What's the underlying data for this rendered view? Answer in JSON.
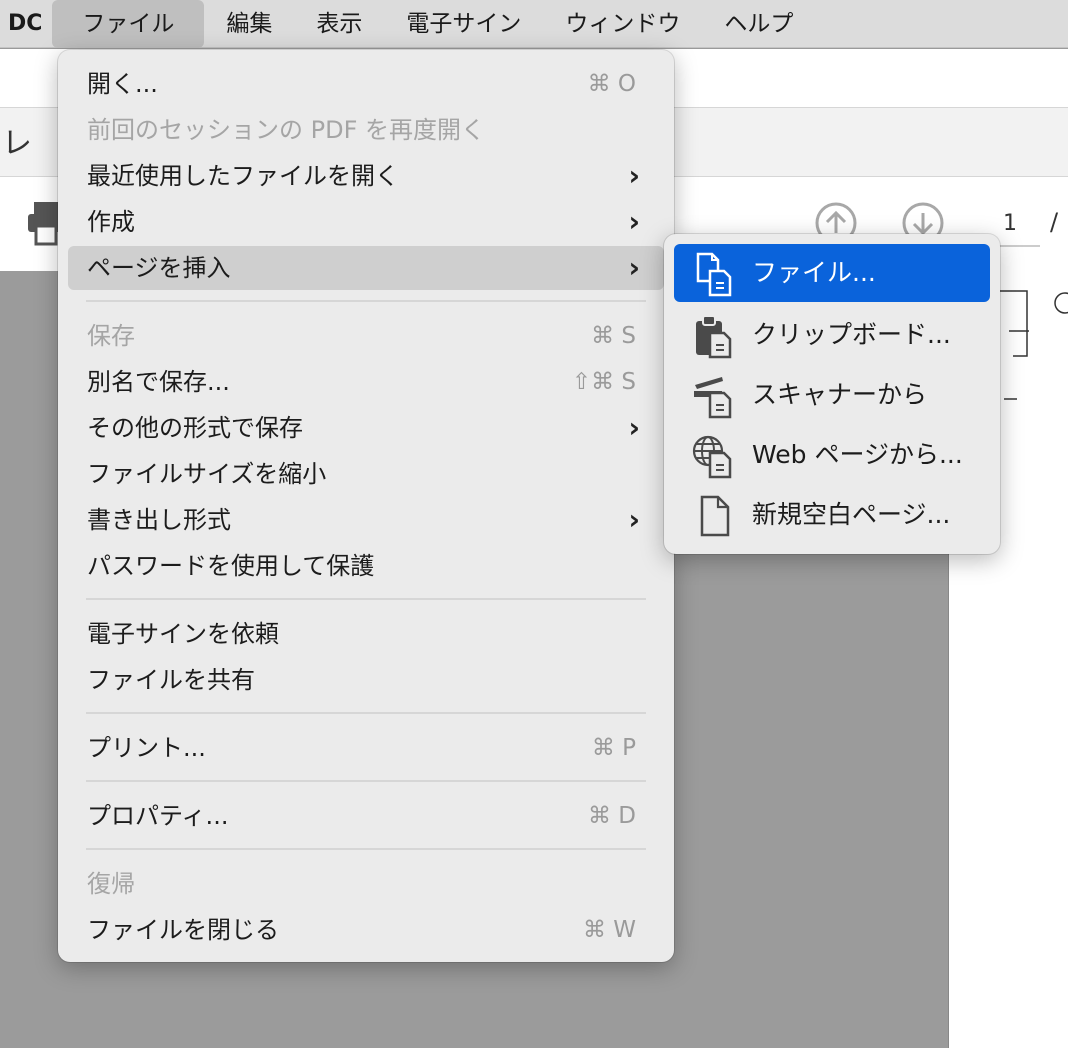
{
  "menubar": {
    "app_name": "DC",
    "items": [
      "ファイル",
      "編集",
      "表示",
      "電子サイン",
      "ウィンドウ",
      "ヘルプ"
    ]
  },
  "background": {
    "tab_fragment": "レ",
    "page_number": "1",
    "page_separator": "/"
  },
  "file_menu": {
    "open": {
      "label": "開く...",
      "shortcut": "⌘ O"
    },
    "reopen_session": {
      "label": "前回のセッションの PDF を再度開く"
    },
    "open_recent": {
      "label": "最近使用したファイルを開く"
    },
    "create": {
      "label": "作成"
    },
    "insert_pages": {
      "label": "ページを挿入"
    },
    "save": {
      "label": "保存",
      "shortcut": "⌘ S"
    },
    "save_as": {
      "label": "別名で保存...",
      "shortcut": "⇧⌘ S"
    },
    "save_as_other": {
      "label": "その他の形式で保存"
    },
    "reduce_size": {
      "label": "ファイルサイズを縮小"
    },
    "export": {
      "label": "書き出し形式"
    },
    "protect_password": {
      "label": "パスワードを使用して保護"
    },
    "request_esign": {
      "label": "電子サインを依頼"
    },
    "share_file": {
      "label": "ファイルを共有"
    },
    "print": {
      "label": "プリント...",
      "shortcut": "⌘ P"
    },
    "properties": {
      "label": "プロパティ...",
      "shortcut": "⌘ D"
    },
    "revert": {
      "label": "復帰"
    },
    "close_file": {
      "label": "ファイルを閉じる",
      "shortcut": "⌘ W"
    },
    "chevron": "›"
  },
  "insert_submenu": {
    "file": {
      "label": "ファイル...",
      "icon": "insert-file-icon"
    },
    "clipboard": {
      "label": "クリップボード...",
      "icon": "clipboard-icon"
    },
    "scanner": {
      "label": "スキャナーから",
      "icon": "scanner-icon"
    },
    "web_page": {
      "label": "Web ページから...",
      "icon": "globe-icon"
    },
    "blank_page": {
      "label": "新規空白ページ...",
      "icon": "blank-page-icon"
    }
  },
  "colors": {
    "selection_blue": "#0a63db",
    "menu_bg": "#ebebeb",
    "highlight_gray": "#cfcfcf"
  }
}
